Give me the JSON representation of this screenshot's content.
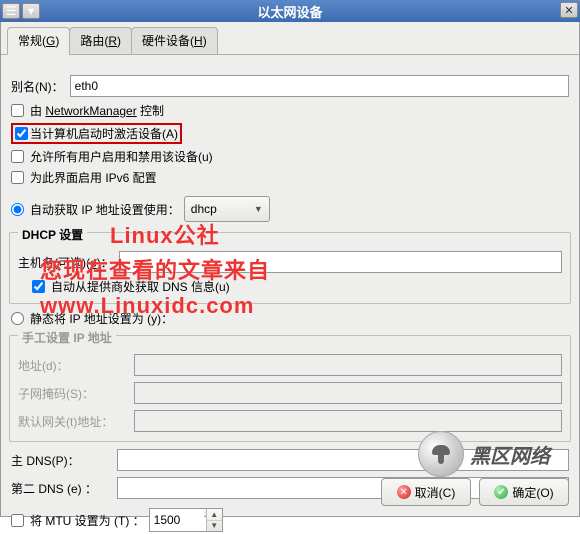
{
  "window": {
    "title": "以太网设备"
  },
  "tabs": [
    {
      "label": "常规(G)"
    },
    {
      "label": "路由(R)"
    },
    {
      "label": "硬件设备(H)"
    }
  ],
  "alias": {
    "label": "别名(N)：",
    "value": "eth0"
  },
  "checkboxes": {
    "nm_control": "由  NetworkManager 控制",
    "activate_on_boot": "当计算机启动时激活设备(A)",
    "allow_all_users": "允许所有用户启用和禁用该设备(u)",
    "enable_ipv6": "为此界面启用 IPv6 配置"
  },
  "ip_mode": {
    "auto_label": "自动获取 IP 地址设置使用：",
    "auto_value": "dhcp",
    "static_label": "静态将 IP 地址设置为 (y)："
  },
  "dhcp": {
    "title": "DHCP 设置",
    "hostname_label_pre": "主机名(可选)(",
    "hostname_label_post": ")：",
    "auto_dns_label": "自动从提供商处获取 DNS 信息(u)"
  },
  "static": {
    "title": "手工设置 IP 地址",
    "address_label": "地址(d)：",
    "netmask_label": "子网掩码(S)：",
    "gateway_label": "默认网关(t)地址："
  },
  "dns": {
    "primary_label": "主 DNS(P)：",
    "secondary_label": "第二 DNS (e) ："
  },
  "mtu": {
    "label": "将 MTU 设置为 (T) ：",
    "value": "1500"
  },
  "buttons": {
    "cancel": "取消(C)",
    "ok": "确定(O)"
  },
  "watermark": {
    "line1": "Linux公社",
    "line2": "您现在查看的文章来自",
    "line3": "www.Linuxidc.com",
    "brand": "黑区网络"
  }
}
